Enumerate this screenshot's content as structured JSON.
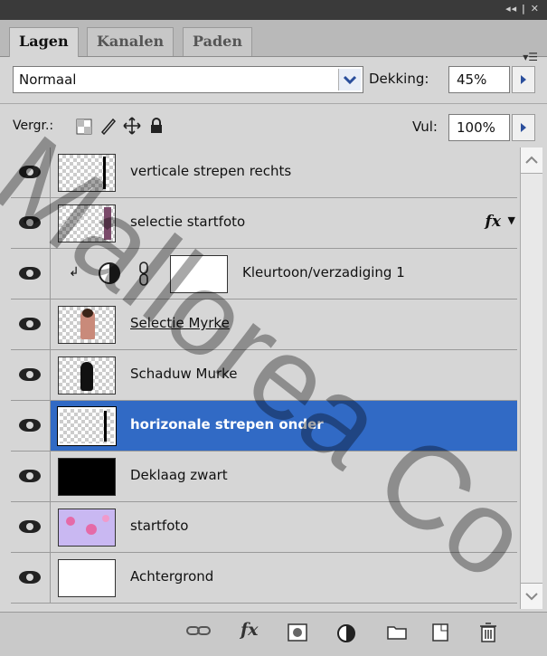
{
  "window": {
    "controls": "◂◂ | ✕"
  },
  "tabs": [
    {
      "label": "Lagen",
      "active": true
    },
    {
      "label": "Kanalen",
      "active": false
    },
    {
      "label": "Paden",
      "active": false
    }
  ],
  "panel_menu_icon": "panel-menu-icon",
  "blend": {
    "mode": "Normaal",
    "opacity_label": "Dekking:",
    "opacity_value": "45%"
  },
  "lock": {
    "label": "Vergr.:",
    "fill_label": "Vul:",
    "fill_value": "100%"
  },
  "layers": [
    {
      "name": "verticale strepen rechts",
      "thumb": "checker-vline",
      "selected": false
    },
    {
      "name": "selectie startfoto",
      "thumb": "checker-photo-edge",
      "selected": false,
      "fx": "fx"
    },
    {
      "name": "Kleurtoon/verzadiging 1",
      "thumb": "adjustment-mask",
      "selected": false
    },
    {
      "name": "Selectie Myrke",
      "thumb": "checker-figure",
      "selected": false
    },
    {
      "name": "Schaduw Murke",
      "thumb": "checker-shadow",
      "selected": false
    },
    {
      "name": "horizonale strepen onder",
      "thumb": "checker-vline",
      "selected": true
    },
    {
      "name": "Deklaag zwart",
      "thumb": "black",
      "selected": false
    },
    {
      "name": "startfoto",
      "thumb": "photo",
      "selected": false
    },
    {
      "name": "Achtergrond",
      "thumb": "white",
      "selected": false
    }
  ],
  "bottom_icons": [
    "link-icon",
    "fx-icon",
    "mask-icon",
    "adjustment-icon",
    "folder-icon",
    "new-layer-icon",
    "trash-icon"
  ],
  "watermark": {
    "text": "Mallorea Co"
  },
  "colors": {
    "selection": "#316ac5",
    "panel": "#d6d6d6"
  }
}
